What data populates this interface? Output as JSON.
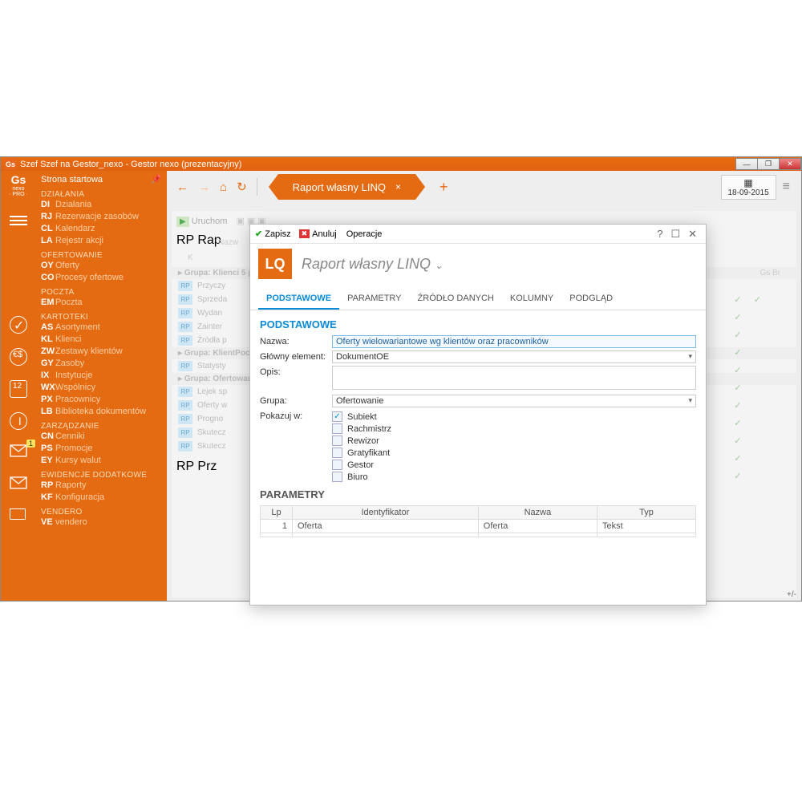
{
  "window": {
    "title": "Szef Szef na Gestor_nexo - Gestor nexo (prezentacyjny)"
  },
  "logo": {
    "line1": "Gs",
    "line2": "nexo",
    "line3": "· PRO ·"
  },
  "sidebar": {
    "top": "Strona startowa",
    "sec_dzialania": "DZIAŁANIA",
    "dzialania": [
      {
        "code": "DI",
        "label": "Działania"
      },
      {
        "code": "RJ",
        "label": "Rezerwacje zasobów"
      },
      {
        "code": "CL",
        "label": "Kalendarz"
      },
      {
        "code": "LA",
        "label": "Rejestr akcji"
      }
    ],
    "sec_ofertowanie": "OFERTOWANIE",
    "ofertowanie": [
      {
        "code": "OY",
        "label": "Oferty"
      },
      {
        "code": "CO",
        "label": "Procesy ofertowe"
      }
    ],
    "sec_poczta": "POCZTA",
    "poczta": [
      {
        "code": "EM",
        "label": "Poczta"
      }
    ],
    "sec_kartoteki": "KARTOTEKI",
    "kartoteki": [
      {
        "code": "AS",
        "label": "Asortyment"
      },
      {
        "code": "KL",
        "label": "Klienci"
      },
      {
        "code": "ZW",
        "label": "Zestawy klientów"
      },
      {
        "code": "GY",
        "label": "Zasoby"
      },
      {
        "code": "IX",
        "label": "Instytucje"
      },
      {
        "code": "WX",
        "label": "Wspólnicy"
      },
      {
        "code": "PX",
        "label": "Pracownicy"
      },
      {
        "code": "LB",
        "label": "Biblioteka dokumentów"
      }
    ],
    "sec_zarzadzanie": "ZARZĄDZANIE",
    "zarzadzanie": [
      {
        "code": "CN",
        "label": "Cenniki"
      },
      {
        "code": "PS",
        "label": "Promocje"
      },
      {
        "code": "EY",
        "label": "Kursy walut"
      }
    ],
    "sec_ewid": "EWIDENCJE DODATKOWE",
    "ewid": [
      {
        "code": "RP",
        "label": "Raporty"
      },
      {
        "code": "KF",
        "label": "Konfiguracja"
      }
    ],
    "sec_vendero": "VENDERO",
    "vendero": [
      {
        "code": "VE",
        "label": "vendero"
      }
    ],
    "badge": "1"
  },
  "toolbar": {
    "tab_label": "Raport własny LINQ",
    "date": "18-09-2015"
  },
  "bg": {
    "uruchom": "Uruchom",
    "rap_short": "RP",
    "rap_title": "Rap",
    "nazw": "Nazw",
    "k": "K",
    "grp1": "Grupa: Klienci 5 p",
    "rows1": [
      "Przyczy",
      "Sprzeda",
      "Wydan",
      "Zainter",
      "Źródła p"
    ],
    "grp2": "Grupa: KlientPocz",
    "rows2": [
      "Statysty"
    ],
    "grp3": "Grupa: Ofertowan",
    "rows3": [
      "Lejek sp",
      "Oferty w",
      "Progno",
      "Skutecz",
      "Skutecz"
    ],
    "prz_title": "Prz",
    "raporty": "Raporty",
    "gb": "Gs      Br"
  },
  "dialog": {
    "save": "Zapisz",
    "cancel": "Anuluj",
    "ops": "Operacje",
    "logo": "LQ",
    "title": "Raport własny LINQ",
    "tabs": [
      "PODSTAWOWE",
      "PARAMETRY",
      "ŹRÓDŁO DANYCH",
      "KOLUMNY",
      "PODGLĄD"
    ],
    "sect_basic": "PODSTAWOWE",
    "lbl_nazwa": "Nazwa:",
    "val_nazwa": "Oferty wielowariantowe wg klientów oraz pracowników",
    "lbl_main": "Główny element:",
    "val_main": "DokumentOE",
    "lbl_opis": "Opis:",
    "lbl_grupa": "Grupa:",
    "val_grupa": "Ofertowanie",
    "lbl_pokaz": "Pokazuj w:",
    "show_opts": [
      {
        "label": "Subiekt",
        "checked": true
      },
      {
        "label": "Rachmistrz",
        "checked": false
      },
      {
        "label": "Rewizor",
        "checked": false
      },
      {
        "label": "Gratyfikant",
        "checked": false
      },
      {
        "label": "Gestor",
        "checked": false
      },
      {
        "label": "Biuro",
        "checked": false
      }
    ],
    "sect_param": "PARAMETRY",
    "th_lp": "Lp",
    "th_id": "Identyfikator",
    "th_nazwa": "Nazwa",
    "th_typ": "Typ",
    "p_lp": "1",
    "p_id": "Oferta",
    "p_nazwa": "Oferta",
    "p_typ": "Tekst"
  },
  "plusminus": "+/-"
}
